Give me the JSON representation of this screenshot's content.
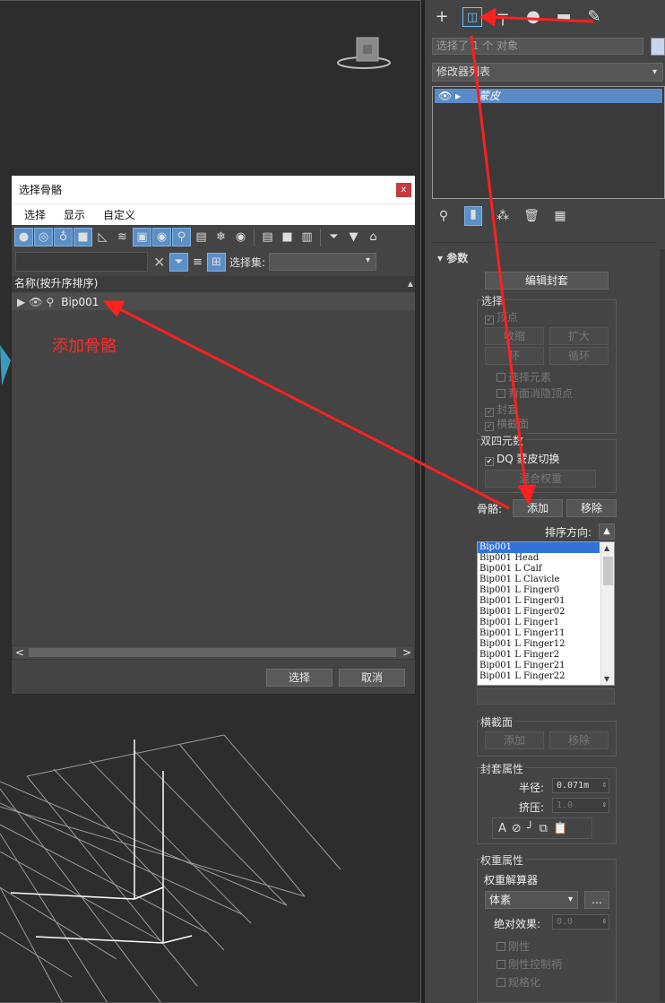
{
  "dialog": {
    "title": "选择骨骼",
    "close": "x",
    "menu": [
      "选择",
      "显示",
      "自定义"
    ],
    "selection_set_label": "选择集:",
    "column_header": "名称(按升序排序)",
    "sort_glyph": "▲",
    "row_bone": "Bip001",
    "select_button": "选择",
    "cancel_button": "取消",
    "scroll_left": "<",
    "scroll_right": ">"
  },
  "panel": {
    "object_name_field": "选择了 1 个 对象",
    "modifier_list": "修改器列表",
    "stack_item": "蒙皮",
    "rollout_title": "参数",
    "edit_envelope": "编辑封套",
    "select_group": {
      "label": "选择",
      "vertices": "顶点",
      "shrink": "收缩",
      "grow": "扩大",
      "ring": "环",
      "loop": "循环",
      "select_element": "选择元素",
      "backface_cull": "背面消隐顶点",
      "envelope": "封套",
      "cross_section": "横截面"
    },
    "dq_group": {
      "label": "双四元数",
      "dq_toggle": "DQ 蒙皮切换",
      "blend_weights": "混合权重"
    },
    "bones_label": "骨骼:",
    "add": "添加",
    "remove": "移除",
    "sort_direction": "排序方向:",
    "bones": [
      "Bip001",
      "Bip001 Head",
      "Bip001 L Calf",
      "Bip001 L Clavicle",
      "Bip001 L Finger0",
      "Bip001 L Finger01",
      "Bip001 L Finger02",
      "Bip001 L Finger1",
      "Bip001 L Finger11",
      "Bip001 L Finger12",
      "Bip001 L Finger2",
      "Bip001 L Finger21",
      "Bip001 L Finger22"
    ],
    "cross_section_group": {
      "label": "横截面",
      "add": "添加",
      "remove": "移除"
    },
    "envelope_props": {
      "label": "封套属性",
      "radius_label": "半径:",
      "radius_value": "0.071m",
      "squash_label": "挤压:",
      "squash_value": "1.0"
    },
    "weight_props": {
      "label": "权重属性",
      "solver_label": "权重解算器",
      "solver_value": "体素",
      "solver_more": "...",
      "abs_effect_label": "绝对效果:",
      "abs_effect_value": "0.0",
      "rigid": "刚性",
      "rigid_handles": "刚性控制柄",
      "normalize": "规格化"
    }
  },
  "annotation": "添加骨骼",
  "colors": {
    "selection_blue": "#3172d8",
    "annotation_red": "#ff2a2a",
    "active_tab": "#6fc0ff"
  }
}
